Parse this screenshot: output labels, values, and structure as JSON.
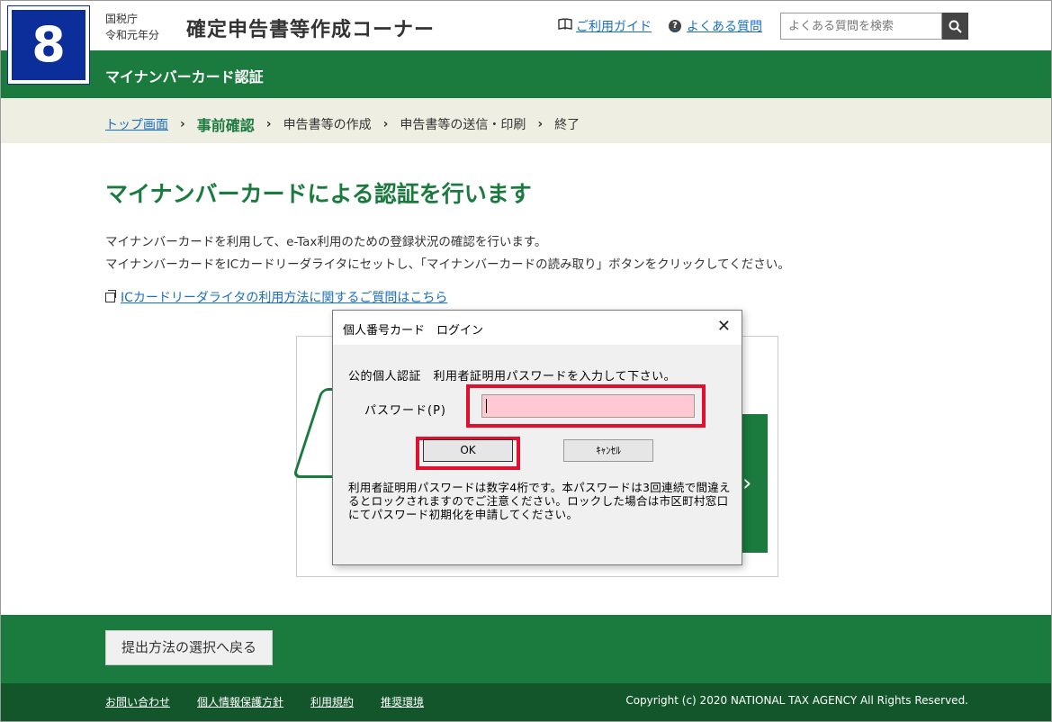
{
  "header": {
    "logo_number": "8",
    "org_line1": "国税庁",
    "org_line2": "令和元年分",
    "app_title": "確定申告書等作成コーナー",
    "guide_link": "ご利用ガイド",
    "faq_link": "よくある質問",
    "search_placeholder": "よくある質問を検索"
  },
  "section_title": "マイナンバーカード認証",
  "breadcrumb": {
    "top": "トップ画面",
    "current": "事前確認",
    "step3": "申告書等の作成",
    "step4": "申告書等の送信・印刷",
    "step5": "終了"
  },
  "main": {
    "heading": "マイナンバーカードによる認証を行います",
    "para1": "マイナンバーカードを利用して、e-Tax利用のための登録状況の確認を行います。",
    "para2": "マイナンバーカードをICカードリーダライタにセットし、「マイナンバーカードの読み取り」ボタンをクリックしてください。",
    "faq_link": "ICカードリーダライタの利用方法に関するご質問はこちら"
  },
  "dialog": {
    "title": "個人番号カード　ログイン",
    "close": "✕",
    "message": "公的個人認証　利用者証明用パスワードを入力して下さい。",
    "password_label": "パスワード(P)",
    "password_value": "",
    "ok_label": "OK",
    "cancel_label": "ｷｬﾝｾﾙ",
    "note": "利用者証明用パスワードは数字4桁です。本パスワードは3回連続で間違えるとロックされますのでご注意ください。ロックした場合は市区町村窓口にてパスワード初期化を申請してください。"
  },
  "footer": {
    "back_button": "提出方法の選択へ戻る",
    "links": [
      "お問い合わせ",
      "個人情報保護方針",
      "利用規約",
      "推奨環境"
    ],
    "copyright": "Copyright (c) 2020 NATIONAL TAX AGENCY All Rights Reserved."
  },
  "colors": {
    "brand_green": "#1b7a3e",
    "logo_blue": "#0b2e9b",
    "highlight_red": "#e0102e",
    "password_field_bg": "#ffc8d2"
  },
  "icons": [
    "book-icon",
    "question-icon",
    "search-icon",
    "external-link-icon",
    "close-icon",
    "chevron-right-icon"
  ]
}
